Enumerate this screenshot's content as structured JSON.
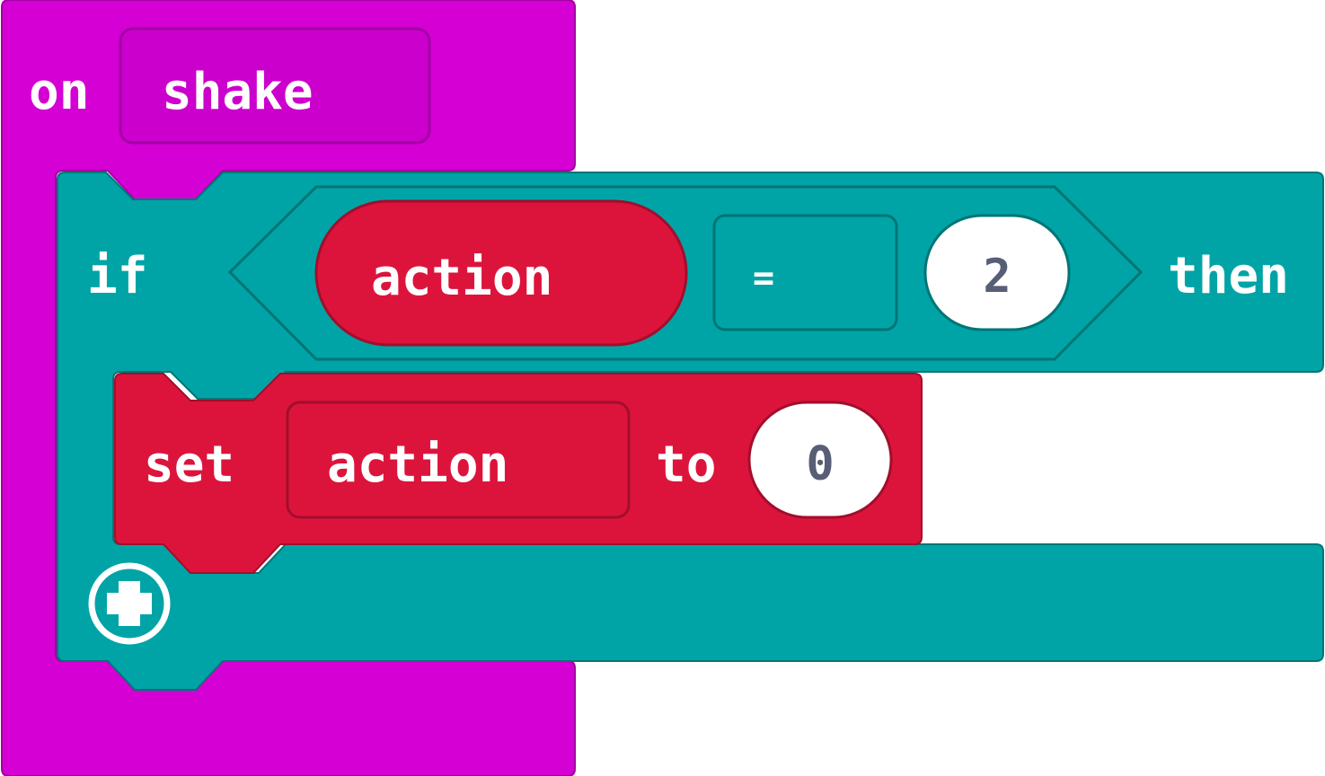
{
  "event_block": {
    "label": "on",
    "dropdown_value": "shake",
    "color": "#D400D4",
    "border_color": "#A300A3"
  },
  "if_block": {
    "label": "if",
    "suffix": "then",
    "color": "#00A4A6",
    "border_color": "#007576",
    "add_branch_icon": "plus-circle-icon",
    "condition": {
      "variable": "action",
      "operator": "=",
      "value": "2",
      "variable_color": "#DC143C"
    }
  },
  "set_block": {
    "label": "set",
    "variable": "action",
    "to_label": "to",
    "value": "0",
    "color": "#DC143C",
    "border_color": "#A20E2C"
  }
}
